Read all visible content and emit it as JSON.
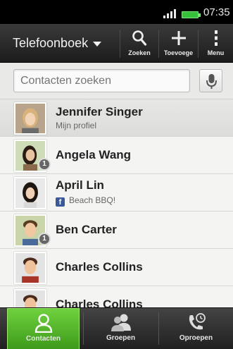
{
  "status_bar": {
    "time": "07:35"
  },
  "action_bar": {
    "title": "Telefoonboek",
    "search_label": "Zoeken",
    "add_label": "Toevoege",
    "menu_label": "Menu"
  },
  "search": {
    "placeholder": "Contacten zoeken"
  },
  "contacts": [
    {
      "name": "Jennifer Singer",
      "subtitle": "Mijn profiel"
    },
    {
      "name": "Angela Wang",
      "badge": "1"
    },
    {
      "name": "April Lin",
      "social_status": "Beach BBQ!",
      "social_icon": "facebook-icon"
    },
    {
      "name": "Ben Carter",
      "badge": "1"
    },
    {
      "name": "Charles Collins"
    },
    {
      "name": "Charles Collins"
    }
  ],
  "bottom_nav": {
    "tabs": [
      {
        "label": "Contacten",
        "icon": "person-icon",
        "active": true
      },
      {
        "label": "Groepen",
        "icon": "group-icon",
        "active": false
      },
      {
        "label": "Oproepen",
        "icon": "call-history-icon",
        "active": false
      }
    ]
  },
  "colors": {
    "active_tab": "#4fb52a",
    "facebook": "#3b5998",
    "battery": "#35c23a"
  }
}
